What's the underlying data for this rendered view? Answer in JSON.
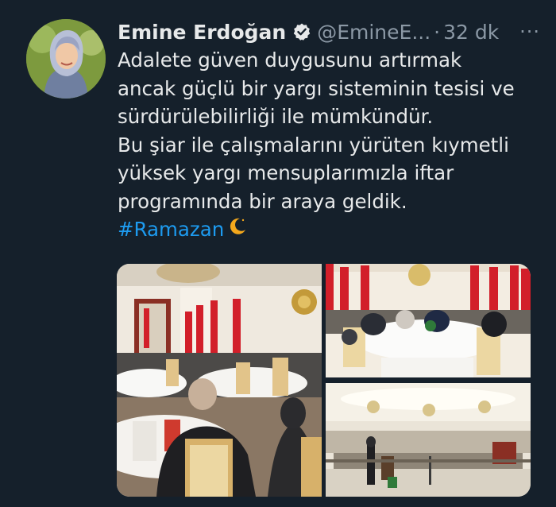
{
  "tweet": {
    "author_name": "Emine Erdoğan",
    "handle": "@EmineE...",
    "separator": "·",
    "time": "32 dk",
    "more": "···",
    "lines": [
      "Adalete güven duygusunu artırmak",
      "ancak güçlü bir yargı sisteminin tesisi ve",
      "sürdürülebilirliği ile mümkündür.",
      "Bu şiar ile çalışmalarını yürüten kıymetli",
      "yüksek yargı mensuplarımızla iftar",
      "programında bir araya geldik."
    ],
    "hashtag": "#Ramazan"
  },
  "icons": {
    "verified": "verified-badge-icon",
    "more": "more-options-icon",
    "moon": "crescent-moon-emoji"
  },
  "colors": {
    "background": "#15202b",
    "text": "#e7e9ea",
    "secondary": "#8b98a5",
    "link": "#1d9bf0"
  }
}
